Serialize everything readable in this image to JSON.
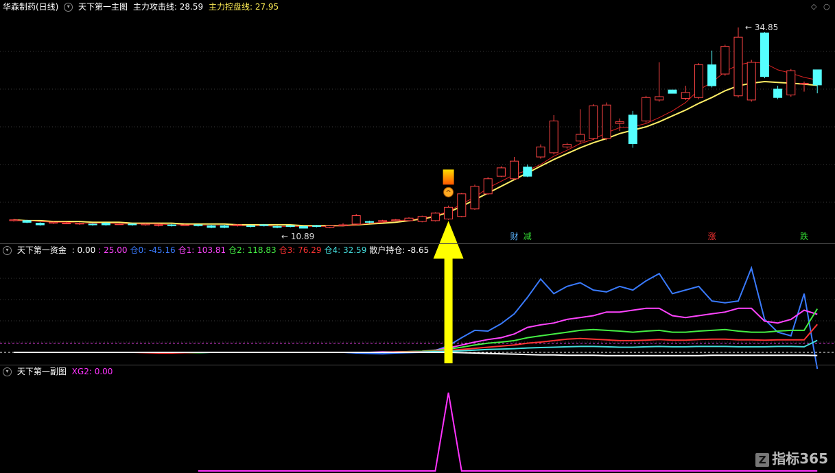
{
  "main_panel": {
    "stock_name": "华森制药(日线)",
    "indicator_name": "天下第一主图",
    "attack_label": "主力攻击线:",
    "attack_value": "28.59",
    "control_label": "主力控盘线:",
    "control_value": "27.95",
    "high_label": "34.85",
    "low_label": "10.89",
    "signals": [
      {
        "text": "财",
        "color": "#5ab4ff",
        "bar": 38
      },
      {
        "text": "减",
        "color": "#33dd33",
        "bar": 39
      },
      {
        "text": "涨",
        "color": "#ff3333",
        "bar": 53
      },
      {
        "text": "跌",
        "color": "#33dd33",
        "bar": 60
      }
    ]
  },
  "fund_panel": {
    "name": "天下第一资金",
    "items": [
      {
        "label": ":",
        "value": "0.00",
        "color": "#ffffff"
      },
      {
        "label": ":",
        "value": "25.00",
        "color": "#ff44ff"
      },
      {
        "label": "仓0:",
        "value": "-45.16",
        "color": "#3a7bff"
      },
      {
        "label": "仓1:",
        "value": "103.81",
        "color": "#ff44ff"
      },
      {
        "label": "仓2:",
        "value": "118.83",
        "color": "#44ee44"
      },
      {
        "label": "仓3:",
        "value": "76.29",
        "color": "#ff3333"
      },
      {
        "label": "仓4:",
        "value": "32.59",
        "color": "#44dddd"
      },
      {
        "label": "散户持仓:",
        "value": "-8.65",
        "color": "#ffffff"
      }
    ]
  },
  "sub_panel": {
    "name": "天下第一副图",
    "label": "XG2:",
    "value": "0.00",
    "color": "#ff33ff"
  },
  "watermark": {
    "icon": "Z",
    "text": "指标365"
  },
  "corner_icons": [
    "diamond-icon",
    "circle-icon"
  ],
  "chart_data": [
    {
      "type": "candlestick",
      "title": "华森制药(日线)",
      "x": [
        0,
        1,
        2,
        3,
        4,
        5,
        6,
        7,
        8,
        9,
        10,
        11,
        12,
        13,
        14,
        15,
        16,
        17,
        18,
        19,
        20,
        21,
        22,
        23,
        24,
        25,
        26,
        27,
        28,
        29,
        30,
        31,
        32,
        33,
        34,
        35,
        36,
        37,
        38,
        39,
        40,
        41,
        42,
        43,
        44,
        45,
        46,
        47,
        48,
        49,
        50,
        51,
        52,
        53,
        54,
        55,
        56,
        57,
        58,
        59,
        60,
        61
      ],
      "open": [
        11.8,
        11.8,
        11.5,
        11.5,
        11.5,
        11.4,
        11.4,
        11.5,
        11.4,
        11.4,
        11.3,
        11.3,
        11.3,
        11.3,
        11.3,
        11.2,
        11.2,
        11.3,
        11.2,
        11.3,
        11.1,
        11.2,
        11.1,
        11.2,
        11.0,
        11.2,
        11.4,
        11.7,
        11.8,
        11.8,
        11.8,
        11.7,
        11.8,
        12.0,
        12.3,
        13.2,
        15.0,
        17.1,
        16.8,
        18.2,
        19.4,
        19.9,
        20.6,
        21.3,
        21.6,
        21.6,
        23.4,
        24.4,
        23.7,
        26.2,
        27.4,
        26.4,
        26.5,
        30.4,
        29.3,
        26.7,
        26.2,
        34.2,
        27.5,
        26.8,
        28.1,
        29.8
      ],
      "close": [
        11.9,
        11.6,
        11.3,
        11.6,
        11.5,
        11.5,
        11.3,
        11.3,
        11.4,
        11.3,
        11.4,
        11.3,
        11.2,
        11.3,
        11.2,
        11.0,
        11.0,
        11.3,
        11.1,
        11.2,
        11.0,
        11.1,
        10.9,
        11.1,
        11.2,
        11.3,
        12.4,
        11.6,
        11.8,
        11.9,
        12.1,
        12.3,
        12.7,
        13.4,
        15.0,
        15.9,
        16.8,
        18.1,
        18.9,
        17.1,
        20.6,
        23.7,
        20.9,
        22.1,
        25.5,
        25.6,
        23.6,
        21.0,
        26.5,
        26.6,
        27.0,
        27.1,
        30.4,
        27.9,
        32.6,
        33.7,
        30.7,
        29.0,
        26.5,
        29.7,
        28.2,
        28.0
      ],
      "high": [
        12.0,
        11.9,
        11.6,
        11.7,
        11.6,
        11.6,
        11.5,
        11.6,
        11.5,
        11.5,
        11.5,
        11.4,
        11.4,
        11.4,
        11.4,
        11.3,
        11.3,
        11.4,
        11.3,
        11.4,
        11.2,
        11.3,
        11.2,
        11.3,
        11.3,
        11.5,
        12.6,
        11.8,
        11.9,
        12.0,
        12.2,
        12.4,
        12.8,
        13.6,
        15.1,
        16.1,
        17.0,
        18.3,
        19.4,
        18.5,
        20.9,
        24.4,
        21.1,
        25.1,
        25.7,
        25.9,
        24.0,
        24.9,
        26.7,
        30.7,
        27.2,
        27.9,
        30.6,
        32.1,
        32.8,
        34.85,
        31.0,
        34.3,
        27.9,
        29.9,
        28.4,
        28.0
      ],
      "low": [
        11.7,
        11.5,
        11.2,
        11.4,
        11.4,
        11.3,
        11.2,
        11.2,
        11.3,
        11.2,
        11.2,
        11.1,
        11.1,
        11.2,
        11.1,
        10.9,
        10.9,
        11.1,
        11.0,
        11.1,
        10.89,
        11.0,
        10.9,
        11.0,
        10.9,
        11.1,
        11.3,
        11.5,
        11.7,
        11.7,
        11.7,
        11.6,
        11.7,
        11.9,
        12.2,
        13.1,
        14.9,
        17.0,
        16.6,
        17.0,
        19.2,
        19.7,
        20.4,
        21.1,
        21.4,
        21.4,
        22.5,
        20.5,
        23.5,
        26.0,
        27.2,
        26.2,
        26.3,
        27.7,
        29.1,
        26.5,
        26.0,
        28.8,
        26.3,
        26.6,
        27.2,
        27.0
      ],
      "attack_line": [
        11.8,
        11.8,
        11.7,
        11.6,
        11.6,
        11.5,
        11.5,
        11.5,
        11.4,
        11.4,
        11.4,
        11.4,
        11.3,
        11.3,
        11.3,
        11.2,
        11.2,
        11.2,
        11.2,
        11.2,
        11.1,
        11.1,
        11.1,
        11.1,
        11.1,
        11.2,
        11.3,
        11.5,
        11.6,
        11.8,
        11.9,
        12.1,
        12.4,
        12.9,
        13.8,
        14.6,
        15.7,
        16.5,
        17.3,
        17.8,
        18.5,
        19.5,
        20.2,
        21.0,
        21.5,
        22.3,
        22.9,
        23.0,
        23.4,
        24.1,
        24.9,
        25.9,
        27.4,
        28.3,
        29.6,
        30.4,
        30.7,
        30.6,
        29.8,
        29.4,
        28.9,
        28.59
      ],
      "control_line": [
        11.9,
        11.8,
        11.8,
        11.7,
        11.7,
        11.7,
        11.6,
        11.6,
        11.6,
        11.5,
        11.5,
        11.5,
        11.5,
        11.4,
        11.4,
        11.4,
        11.4,
        11.3,
        11.3,
        11.3,
        11.3,
        11.3,
        11.2,
        11.2,
        11.2,
        11.2,
        11.3,
        11.4,
        11.5,
        11.6,
        11.8,
        12.0,
        12.3,
        12.8,
        13.5,
        14.3,
        15.1,
        15.9,
        16.7,
        17.5,
        18.3,
        19.1,
        19.8,
        20.5,
        21.1,
        21.6,
        22.2,
        22.6,
        23.0,
        23.6,
        24.3,
        25.0,
        25.8,
        26.5,
        27.3,
        27.9,
        28.2,
        28.4,
        28.3,
        28.2,
        28.1,
        27.95
      ],
      "ylim": [
        9.5,
        36.5
      ]
    },
    {
      "type": "line",
      "title": "天下第一资金",
      "x": [
        0,
        1,
        2,
        3,
        4,
        5,
        6,
        7,
        8,
        9,
        10,
        11,
        12,
        13,
        14,
        15,
        16,
        17,
        18,
        19,
        20,
        21,
        22,
        23,
        24,
        25,
        26,
        27,
        28,
        29,
        30,
        31,
        32,
        33,
        34,
        35,
        36,
        37,
        38,
        39,
        40,
        41,
        42,
        43,
        44,
        45,
        46,
        47,
        48,
        49,
        50,
        51,
        52,
        53,
        54,
        55,
        56,
        57,
        58,
        59,
        60,
        61
      ],
      "series": [
        {
          "name": "仓0",
          "color": "#3a7bff",
          "values": [
            0,
            0,
            0,
            0,
            0,
            0,
            0,
            0,
            0,
            0,
            0,
            0,
            0,
            0,
            -1,
            0,
            0,
            0,
            0,
            0,
            0,
            0,
            0,
            0,
            0,
            0,
            -2,
            -3,
            -4,
            -2,
            -1,
            0,
            5,
            18,
            40,
            60,
            58,
            78,
            105,
            150,
            200,
            160,
            180,
            190,
            170,
            165,
            180,
            170,
            195,
            215,
            160,
            170,
            180,
            140,
            135,
            140,
            230,
            90,
            55,
            45,
            160,
            -45.16
          ]
        },
        {
          "name": "仓1",
          "color": "#ff44ff",
          "values": [
            0,
            0,
            0,
            0,
            0,
            0,
            0,
            0,
            0,
            0,
            0,
            0,
            0,
            0,
            0,
            0,
            0,
            0,
            0,
            0,
            0,
            0,
            0,
            0,
            0,
            0,
            0,
            0,
            1,
            1,
            2,
            3,
            6,
            12,
            20,
            28,
            35,
            40,
            50,
            68,
            75,
            80,
            90,
            95,
            100,
            110,
            110,
            115,
            120,
            120,
            100,
            95,
            100,
            105,
            110,
            120,
            120,
            85,
            80,
            90,
            115,
            103.81
          ]
        },
        {
          "name": "仓2",
          "color": "#44ee44",
          "values": [
            0,
            0,
            0,
            0,
            0,
            0,
            0,
            0,
            0,
            0,
            0,
            0,
            -1,
            -1,
            -1,
            0,
            0,
            0,
            0,
            0,
            0,
            0,
            0,
            0,
            0,
            0,
            0,
            0,
            0,
            1,
            2,
            3,
            5,
            9,
            14,
            20,
            25,
            28,
            32,
            40,
            45,
            50,
            55,
            60,
            62,
            60,
            58,
            55,
            58,
            60,
            55,
            55,
            58,
            60,
            62,
            58,
            55,
            55,
            58,
            60,
            60,
            118.83
          ]
        },
        {
          "name": "仓3",
          "color": "#ff3333",
          "values": [
            0,
            0,
            0,
            0,
            0,
            0,
            0,
            0,
            0,
            0,
            -1,
            -2,
            -2,
            -1,
            0,
            0,
            0,
            0,
            0,
            0,
            0,
            0,
            0,
            0,
            0,
            0,
            0,
            0,
            0,
            1,
            1,
            2,
            3,
            5,
            8,
            11,
            14,
            17,
            20,
            25,
            28,
            32,
            36,
            38,
            36,
            34,
            32,
            32,
            33,
            35,
            33,
            33,
            35,
            36,
            36,
            34,
            34,
            33,
            34,
            34,
            34,
            76.29
          ]
        },
        {
          "name": "仓4",
          "color": "#44dddd",
          "values": [
            0,
            0,
            0,
            0,
            0,
            0,
            0,
            0,
            0,
            0,
            0,
            0,
            0,
            0,
            0,
            0,
            0,
            0,
            0,
            0,
            0,
            0,
            0,
            0,
            0,
            0,
            0,
            0,
            0,
            0,
            0,
            1,
            2,
            3,
            4,
            6,
            8,
            9,
            10,
            12,
            13,
            14,
            15,
            16,
            16,
            15,
            14,
            14,
            15,
            16,
            15,
            15,
            16,
            16,
            16,
            15,
            15,
            15,
            16,
            16,
            15,
            32.59
          ]
        },
        {
          "name": "散户持仓",
          "color": "#ffffff",
          "values": [
            0,
            0,
            0,
            0,
            0,
            0,
            0,
            0,
            0,
            0,
            0,
            0,
            0,
            0,
            0,
            0,
            0,
            0,
            0,
            0,
            0,
            0,
            0,
            0,
            0,
            0,
            0,
            0,
            0,
            0,
            0,
            0,
            0,
            0,
            -1,
            -2,
            -3,
            -4,
            -5,
            -6,
            -7,
            -7,
            -8,
            -8,
            -8,
            -9,
            -9,
            -9,
            -9,
            -9,
            -9,
            -9,
            -9,
            -8,
            -8,
            -8,
            -8,
            -8,
            -8,
            -8,
            -8,
            -8.65
          ]
        }
      ],
      "ref_lines": [
        {
          "value": 0,
          "color": "#ffffff"
        },
        {
          "value": 25,
          "color": "#ff44ff"
        }
      ],
      "ylim": [
        -30,
        260
      ]
    },
    {
      "type": "line",
      "title": "天下第一副图",
      "x": [
        0,
        1,
        2,
        3,
        4,
        5,
        6,
        7,
        8,
        9,
        10,
        11,
        12,
        13,
        14,
        15,
        16,
        17,
        18,
        19,
        20,
        21,
        22,
        23,
        24,
        25,
        26,
        27,
        28,
        29,
        30,
        31,
        32,
        33,
        34,
        35,
        36,
        37,
        38,
        39,
        40,
        41,
        42,
        43,
        44,
        45,
        46,
        47,
        48,
        49,
        50,
        51,
        52,
        53,
        54,
        55,
        56,
        57,
        58,
        59,
        60,
        61
      ],
      "series": [
        {
          "name": "XG2",
          "color": "#ff33ff",
          "values": [
            null,
            null,
            null,
            null,
            null,
            null,
            null,
            null,
            null,
            null,
            null,
            null,
            null,
            null,
            0,
            0,
            0,
            0,
            0,
            0,
            0,
            0,
            0,
            0,
            0,
            0,
            0,
            0,
            0,
            0,
            0,
            0,
            0,
            1,
            0,
            0,
            0,
            0,
            0,
            0,
            0,
            0,
            0,
            0,
            0,
            0,
            0,
            0,
            0,
            0,
            0,
            0,
            0,
            0,
            0,
            0,
            0,
            0,
            0,
            0,
            0,
            0
          ]
        }
      ],
      "ylim": [
        0,
        1.2
      ]
    }
  ]
}
